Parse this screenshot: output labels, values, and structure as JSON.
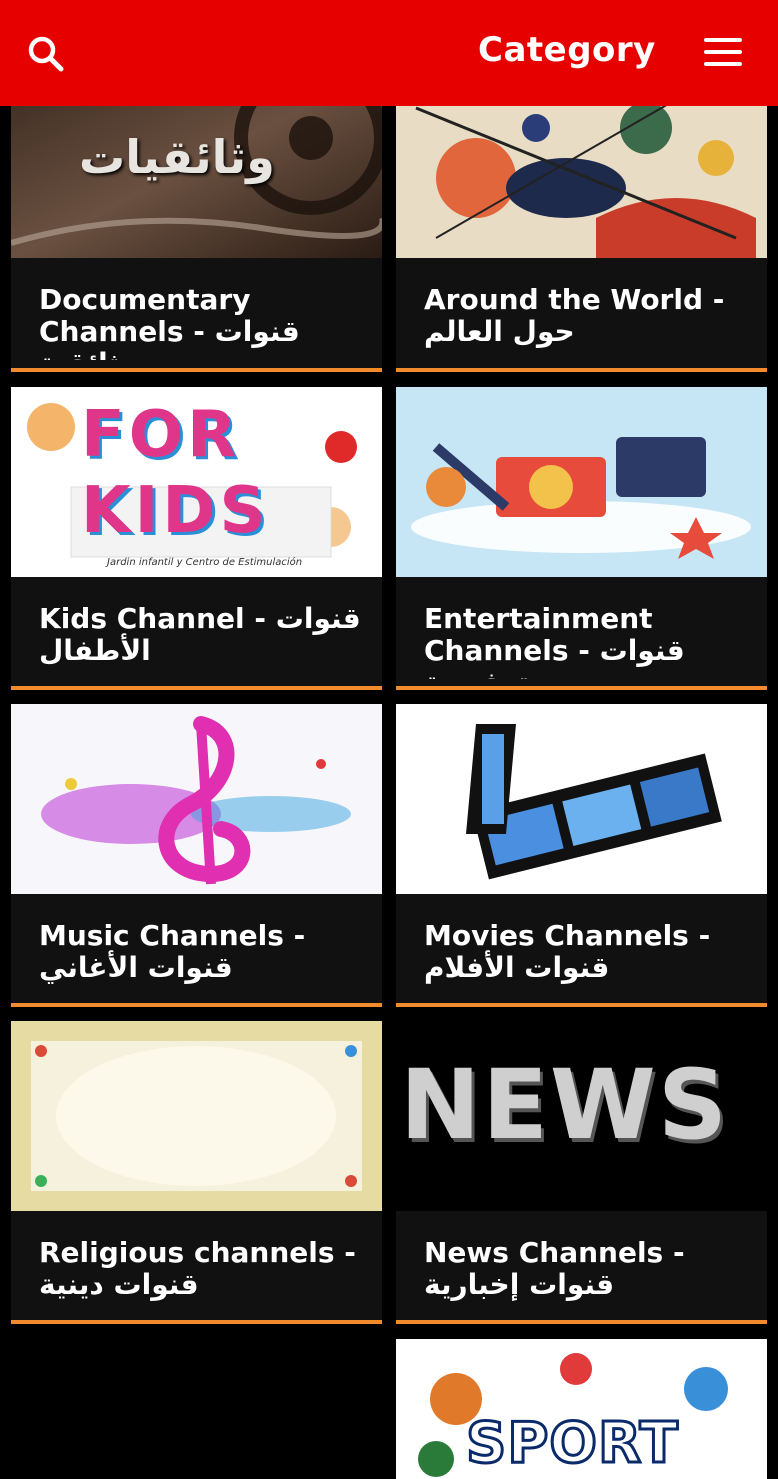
{
  "header": {
    "title": "Category",
    "search_icon": "search-icon",
    "menu_icon": "hamburger-menu-icon"
  },
  "colors": {
    "header_bg": "#e60000",
    "card_bg": "#111111",
    "accent_rule": "#f28a2e",
    "page_bg": "#000000"
  },
  "categories": [
    {
      "label": "Documentary Channels - قنوات وثائقية",
      "thumb_text": "وثائقيات"
    },
    {
      "label": "Around the World - حول العالم"
    },
    {
      "label": "Kids Channel - قنوات الأطفال",
      "thumb_text": "FOR KIDS",
      "thumb_subtext": "Jardin infantil y Centro de Estimulación"
    },
    {
      "label": "Entertainment Channels - قنوات ترفيهية"
    },
    {
      "label": "Music Channels - قنوات الأغاني"
    },
    {
      "label": "Movies Channels - قنوات الأفلام"
    },
    {
      "label": "Religious channels - قنوات دينية"
    },
    {
      "label": "News Channels - قنوات إخبارية",
      "thumb_text": "NEWS"
    },
    {
      "label": "",
      "thumb_text": "SPORT"
    }
  ]
}
